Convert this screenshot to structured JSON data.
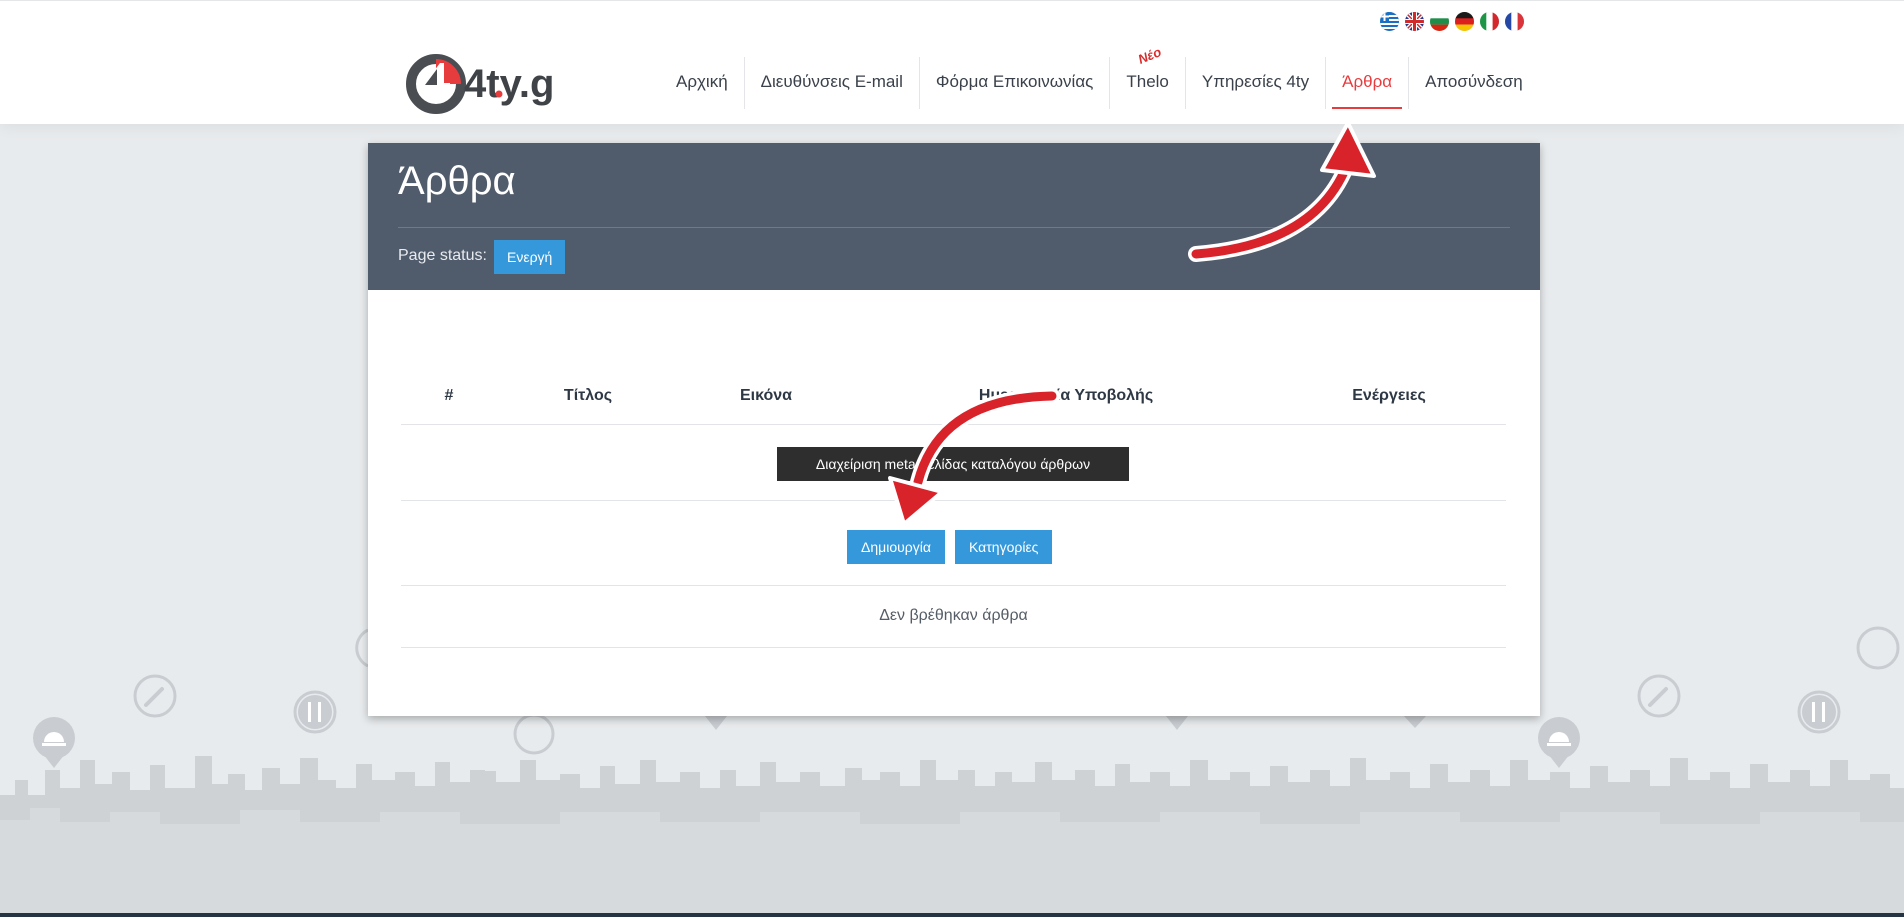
{
  "header": {
    "logo_text": "4ty.gr",
    "languages": [
      {
        "code": "el",
        "icon": "flag-greece-icon"
      },
      {
        "code": "en",
        "icon": "flag-uk-icon"
      },
      {
        "code": "bg",
        "icon": "flag-bulgaria-icon"
      },
      {
        "code": "de",
        "icon": "flag-germany-icon"
      },
      {
        "code": "it",
        "icon": "flag-italy-icon"
      },
      {
        "code": "fr",
        "icon": "flag-france-icon"
      }
    ],
    "nav": [
      {
        "label": "Αρχική"
      },
      {
        "label": "Διευθύνσεις E-mail"
      },
      {
        "label": "Φόρμα Επικοινωνίας"
      },
      {
        "label": "Thelo",
        "badge": "Νέο"
      },
      {
        "label": "Υπηρεσίες 4ty"
      },
      {
        "label": "Άρθρα",
        "active": true
      },
      {
        "label": "Αποσύνδεση"
      }
    ]
  },
  "page": {
    "title": "Άρθρα",
    "status_label": "Page status:",
    "status_value": "Ενεργή"
  },
  "table": {
    "columns": [
      "#",
      "Τίτλος",
      "Εικόνα",
      "Ημερομηνία Υποβολής",
      "Ενέργειες"
    ],
    "meta_button": "Διαχείριση meta σελίδας καταλόγου άρθρων",
    "create_button": "Δημιουργία",
    "categories_button": "Κατηγορίες",
    "empty_message": "Δεν βρέθηκαν άρθρα"
  },
  "colors": {
    "accent_red": "#e73c3e",
    "header_bar": "#505b6b",
    "button_blue": "#3498db",
    "meta_button_dark": "#2e2e2e"
  }
}
